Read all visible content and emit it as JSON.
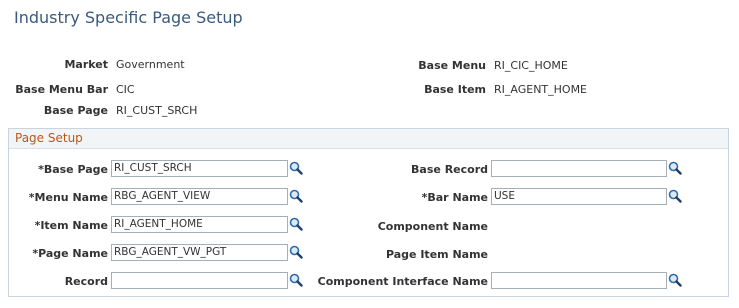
{
  "page": {
    "title": "Industry Specific Page Setup"
  },
  "summary": {
    "market_label": "Market",
    "market_value": "Government",
    "base_menu_label": "Base Menu",
    "base_menu_value": "RI_CIC_HOME",
    "base_menu_bar_label": "Base Menu Bar",
    "base_menu_bar_value": "CIC",
    "base_item_label": "Base Item",
    "base_item_value": "RI_AGENT_HOME",
    "base_page_label": "Base Page",
    "base_page_value": "RI_CUST_SRCH"
  },
  "section": {
    "title": "Page Setup",
    "base_page_label": "*Base Page",
    "base_page_value": "RI_CUST_SRCH",
    "menu_name_label": "*Menu Name",
    "menu_name_value": "RBG_AGENT_VIEW",
    "item_name_label": "*Item Name",
    "item_name_value": "RI_AGENT_HOME",
    "page_name_label": "*Page Name",
    "page_name_value": "RBG_AGENT_VW_PGT",
    "record_label": "Record",
    "record_value": "",
    "base_record_label": "Base Record",
    "base_record_value": "",
    "bar_name_label": "*Bar Name",
    "bar_name_value": "USE",
    "component_name_label": "Component Name",
    "page_item_name_label": "Page Item Name",
    "component_interface_name_label": "Component Interface Name",
    "component_interface_name_value": ""
  },
  "icons": {
    "lookup": "magnifier-icon"
  },
  "colors": {
    "title": "#3a5a7c",
    "section_title": "#b8561a",
    "section_border": "#c9d4de"
  }
}
